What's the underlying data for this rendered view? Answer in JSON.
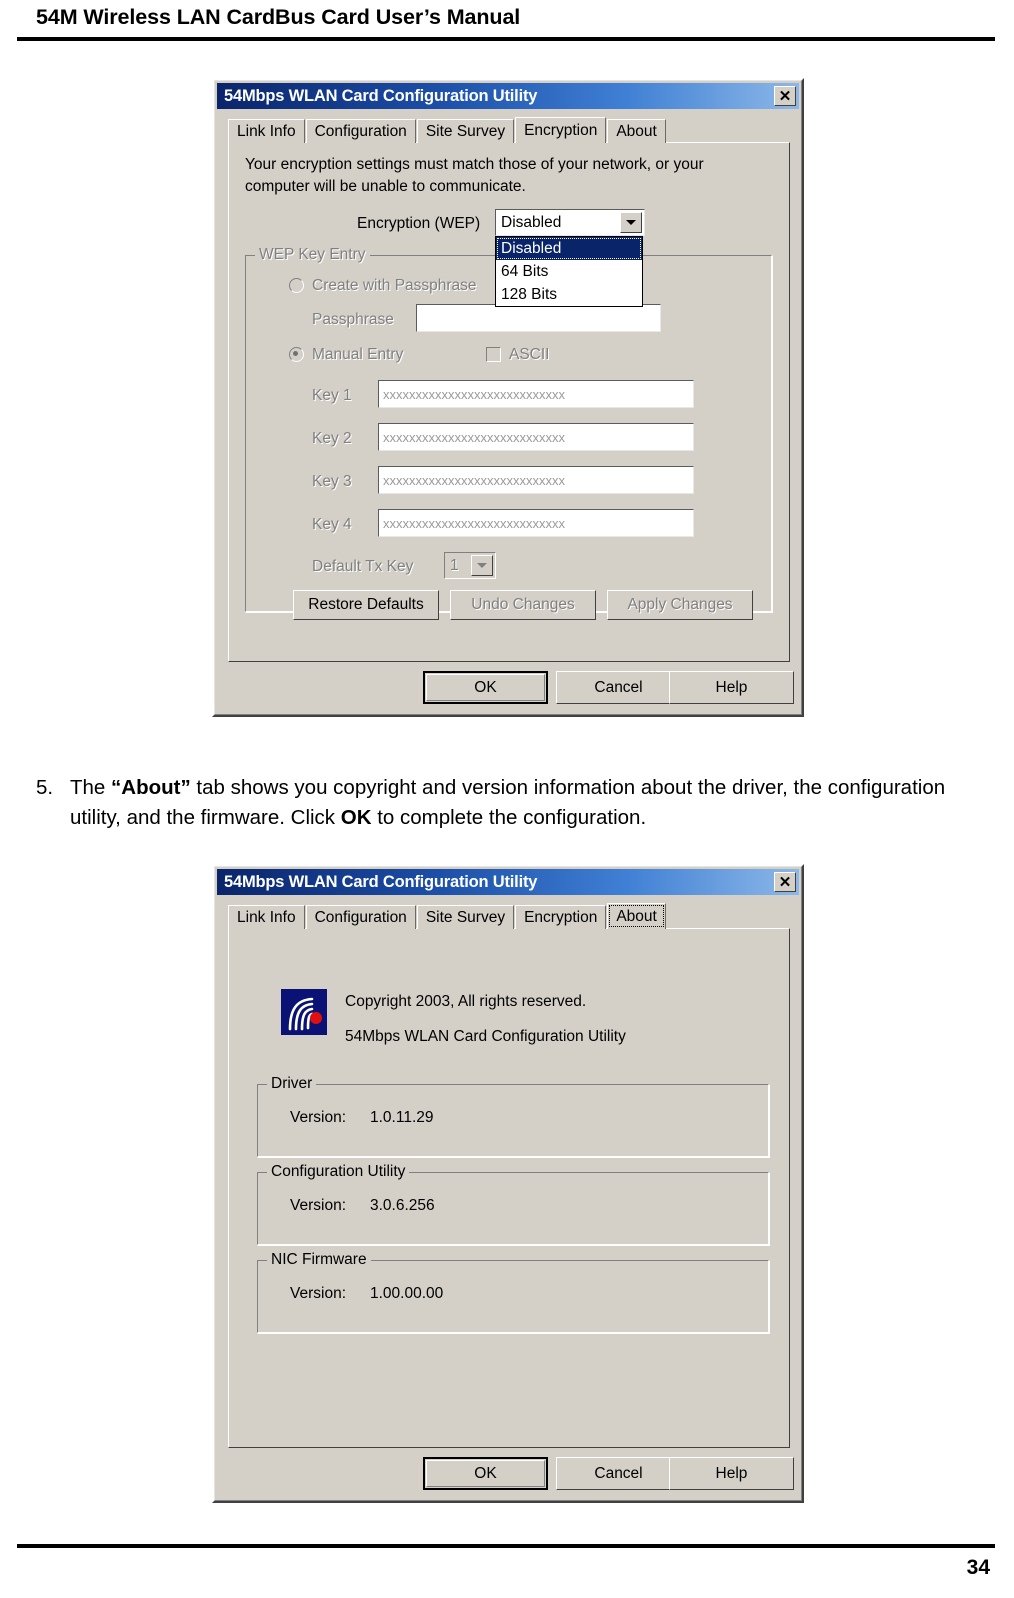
{
  "page": {
    "header_title": "54M Wireless LAN CardBus Card User’s Manual",
    "page_number": "34"
  },
  "step": {
    "number": "5.",
    "text_part1": "The ",
    "bold1": "“About”",
    "text_part2": " tab shows you copyright and version information about the driver, the configuration utility, and the firmware. Click ",
    "bold2": "OK",
    "text_part3": " to complete the configuration."
  },
  "colors": {
    "titlebar_start": "#0a246a",
    "titlebar_end": "#8cb8e8",
    "dialog_face": "#d4d0c8",
    "highlight": "#0a246a",
    "disabled_text": "#808080",
    "logo_bg": "#0b1275",
    "logo_dot": "#e01010"
  },
  "encryption_dialog": {
    "title": "54Mbps WLAN Card Configuration Utility",
    "close_icon": "close-icon",
    "tabs": [
      {
        "label": "Link Info",
        "active": false
      },
      {
        "label": "Configuration",
        "active": false
      },
      {
        "label": "Site Survey",
        "active": false
      },
      {
        "label": "Encryption",
        "active": true
      },
      {
        "label": "About",
        "active": false
      }
    ],
    "description_line1": "Your encryption settings must match those of your network, or your",
    "description_line2": "computer will be unable to communicate.",
    "encryption_label": "Encryption (WEP)",
    "encryption_value": "Disabled",
    "encryption_options": [
      "Disabled",
      "64 Bits",
      "128 Bits"
    ],
    "encryption_selected_index": 0,
    "wep_group_title": "WEP Key Entry",
    "passphrase_radio_label": "Create with Passphrase",
    "passphrase_label": "Passphrase",
    "passphrase_value": "",
    "manual_radio_label": "Manual Entry",
    "ascii_checkbox_label": "ASCII",
    "ascii_checked": false,
    "keys": [
      {
        "label": "Key 1",
        "value": "xxxxxxxxxxxxxxxxxxxxxxxxxxxx"
      },
      {
        "label": "Key 2",
        "value": "xxxxxxxxxxxxxxxxxxxxxxxxxxxx"
      },
      {
        "label": "Key 3",
        "value": "xxxxxxxxxxxxxxxxxxxxxxxxxxxx"
      },
      {
        "label": "Key 4",
        "value": "xxxxxxxxxxxxxxxxxxxxxxxxxxxx"
      }
    ],
    "default_tx_key_label": "Default Tx Key",
    "default_tx_key_value": "1",
    "restore_defaults_label": "Restore Defaults",
    "undo_changes_label": "Undo Changes",
    "apply_changes_label": "Apply Changes",
    "ok_label": "OK",
    "cancel_label": "Cancel",
    "help_label": "Help"
  },
  "about_dialog": {
    "title": "54Mbps WLAN Card Configuration Utility",
    "close_icon": "close-icon",
    "tabs": [
      {
        "label": "Link Info",
        "active": false
      },
      {
        "label": "Configuration",
        "active": false
      },
      {
        "label": "Site Survey",
        "active": false
      },
      {
        "label": "Encryption",
        "active": false
      },
      {
        "label": "About",
        "active": true
      }
    ],
    "logo_icon": "wireless-signal-logo-icon",
    "copyright_line": "Copyright 2003, All rights reserved.",
    "product_line": "54Mbps WLAN Card Configuration Utility",
    "groups": [
      {
        "title": "Driver",
        "version_label": "Version:",
        "version_value": "1.0.11.29"
      },
      {
        "title": "Configuration Utility",
        "version_label": "Version:",
        "version_value": "3.0.6.256"
      },
      {
        "title": "NIC Firmware",
        "version_label": "Version:",
        "version_value": "1.00.00.00"
      }
    ],
    "ok_label": "OK",
    "cancel_label": "Cancel",
    "help_label": "Help"
  }
}
